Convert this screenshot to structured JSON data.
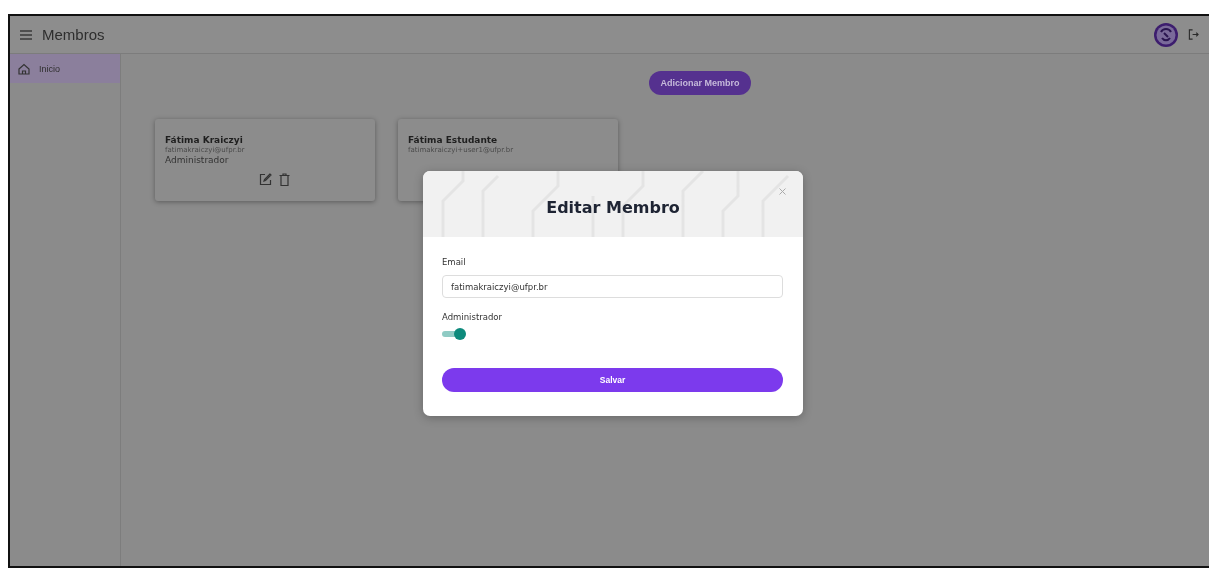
{
  "app_bar": {
    "title": "Membros"
  },
  "sidebar": {
    "items": [
      {
        "label": "Inicio",
        "selected": true
      }
    ]
  },
  "add_button": "Adicionar Membro",
  "members": [
    {
      "name": "Fátima Kraiczyi",
      "email": "fatimakraiczyi@ufpr.br",
      "role": "Administrador"
    },
    {
      "name": "Fátima Estudante",
      "email": "fatimakraiczyi+user1@ufpr.br"
    }
  ],
  "dialog": {
    "title": "Editar Membro",
    "email_label": "Email",
    "email_value": "fatimakraiczyi@ufpr.br",
    "admin_label": "Administrador",
    "admin_on": true,
    "save_button": "Salvar"
  }
}
